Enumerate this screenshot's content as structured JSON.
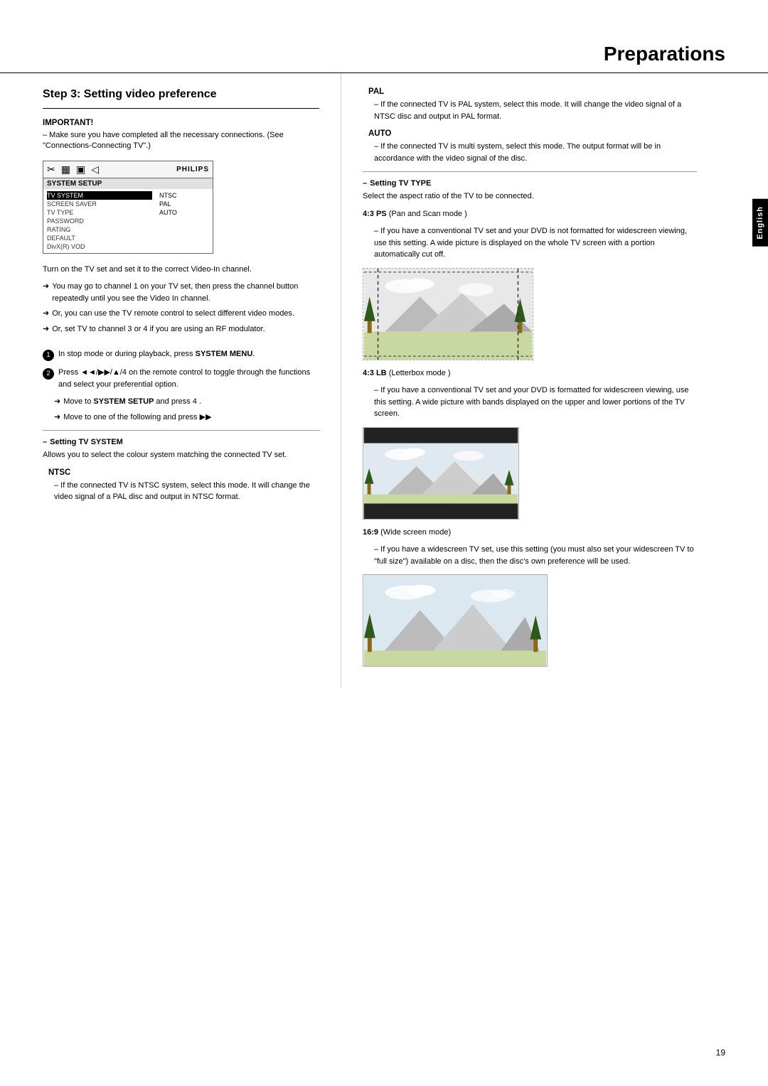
{
  "page": {
    "title": "Preparations",
    "page_number": "19",
    "language_tab": "English"
  },
  "left": {
    "step_heading": "Step 3:  Setting video preference",
    "important_label": "IMPORTANT!",
    "important_text": "–  Make sure you have completed all the necessary connections. (See \"Connections-Connecting TV\".)",
    "menu": {
      "icons": [
        "✂",
        "▦",
        "▣",
        "◁"
      ],
      "brand": "PHILIPS",
      "title": "SYSTEM SETUP",
      "items": [
        {
          "label": "TV SYSTEM",
          "value": "NTSC"
        },
        {
          "label": "SCREEN SAVER",
          "value": "PAL"
        },
        {
          "label": "TV TYPE",
          "value": "AUTO"
        },
        {
          "label": "PASSWORD",
          "value": ""
        },
        {
          "label": "RATING",
          "value": ""
        },
        {
          "label": "DEFAULT",
          "value": ""
        },
        {
          "label": "DivX(R) VOD",
          "value": ""
        }
      ]
    },
    "body1": "Turn on the TV set and set it to the correct Video-In channel.",
    "arrow1": "➜ You may go to channel 1 on your TV set, then press the channel button repeatedly until you see the Video In channel.",
    "arrow2": "➜ Or, you can use the TV remote control to select different video modes.",
    "arrow3": "➜ Or, set TV to channel 3 or 4 if you are using an RF modulator.",
    "step1_prefix": "In stop mode or during playback, press",
    "step1_bold": "SYSTEM MENU",
    "step2_text": "Press ◄◄/▶▶/▲/4  on the remote control to toggle through the functions and select your preferential option.",
    "arrow4": "➜ Move to SYSTEM SETUP and press 4 .",
    "arrow5": "➜ Move to one of the following and press ▶▶",
    "sub_heading1": "–  Setting TV SYSTEM",
    "sub_text1": "Allows you to select the colour system matching the connected TV set.",
    "ntsc_label": "NTSC",
    "ntsc_text": "–  If the connected TV is NTSC system, select this mode. It will change the video signal of a PAL disc and output in NTSC format."
  },
  "right": {
    "pal_label": "PAL",
    "pal_text": "–  If the connected TV is PAL system, select this mode. It will change the video signal of a NTSC disc and output in PAL format.",
    "auto_label": "AUTO",
    "auto_text": "–  If the connected TV is multi system, select this mode. The output format will be in accordance with the video signal of the disc.",
    "sub_heading2": "–  Setting TV TYPE",
    "sub_heading2_text": "Select the aspect ratio of the TV to be connected.",
    "ps_label": "4:3 PS",
    "ps_label_suffix": "(Pan and Scan mode )",
    "ps_text": "–  If you have a conventional TV set and your DVD is not formatted for widescreen viewing, use this setting. A wide picture is displayed on the whole TV screen with a portion automatically cut off.",
    "lb_label": "4:3 LB",
    "lb_label_suffix": "(Letterbox mode )",
    "lb_text": "–  If you have a conventional TV set and your DVD is formatted for widescreen viewing, use this setting. A wide picture with bands displayed on the upper and lower portions of the TV screen.",
    "wide_label": "16:9",
    "wide_label_suffix": "(Wide screen mode)",
    "wide_text": "–  If you have a widescreen TV set, use this setting (you must also set your widescreen TV to \"full size\") available on a disc, then the disc's own preference will be used."
  }
}
